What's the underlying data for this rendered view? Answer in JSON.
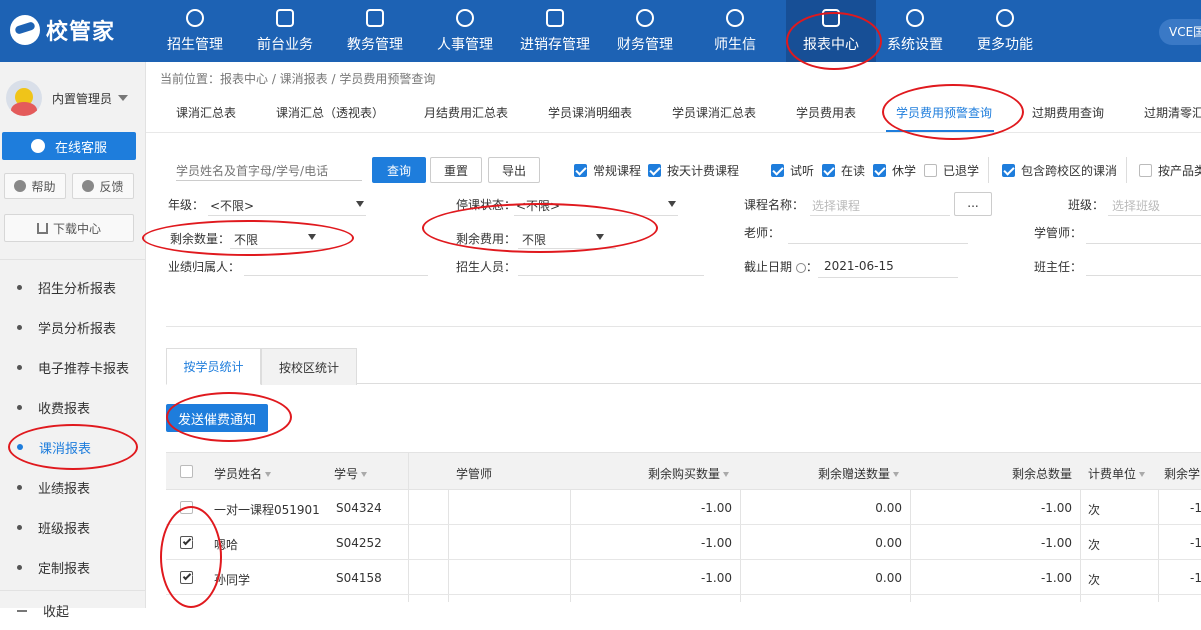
{
  "app": {
    "logo_text": "校管家",
    "user_badge": "VCE国"
  },
  "nav": [
    {
      "label": "招生管理",
      "icon": "user-plus-icon"
    },
    {
      "label": "前台业务",
      "icon": "id-card-icon"
    },
    {
      "label": "教务管理",
      "icon": "book-icon"
    },
    {
      "label": "人事管理",
      "icon": "person-icon"
    },
    {
      "label": "进销存管理",
      "icon": "inventory-icon"
    },
    {
      "label": "财务管理",
      "icon": "finance-icon"
    },
    {
      "label": "师生信",
      "icon": "chat-icon"
    },
    {
      "label": "报表中心",
      "icon": "report-icon"
    },
    {
      "label": "系统设置",
      "icon": "settings-icon"
    },
    {
      "label": "更多功能",
      "icon": "more-icon"
    }
  ],
  "sidebar": {
    "user_name": "内置管理员",
    "support_label": "在线客服",
    "help_label": "帮助",
    "feedback_label": "反馈",
    "download_label": "下载中心",
    "items": [
      {
        "label": "招生分析报表"
      },
      {
        "label": "学员分析报表"
      },
      {
        "label": "电子推荐卡报表"
      },
      {
        "label": "收费报表"
      },
      {
        "label": "课消报表"
      },
      {
        "label": "业绩报表"
      },
      {
        "label": "班级报表"
      },
      {
        "label": "定制报表"
      },
      {
        "label": "收起"
      }
    ]
  },
  "breadcrumb": "当前位置：报表中心 / 课消报表 / 学员费用预警查询",
  "tabs": [
    {
      "label": "课消汇总表"
    },
    {
      "label": "课消汇总（透视表）"
    },
    {
      "label": "月结费用汇总表"
    },
    {
      "label": "学员课消明细表"
    },
    {
      "label": "学员课消汇总表"
    },
    {
      "label": "学员费用表"
    },
    {
      "label": "学员费用预警查询"
    },
    {
      "label": "过期费用查询"
    },
    {
      "label": "过期清零汇"
    }
  ],
  "search": {
    "placeholder": "学员姓名及首字母/学号/电话",
    "query_btn": "查询",
    "reset_btn": "重置",
    "export_btn": "导出"
  },
  "checks": [
    {
      "label": "常规课程",
      "checked": true
    },
    {
      "label": "按天计费课程",
      "checked": true
    },
    {
      "label": "试听",
      "checked": true
    },
    {
      "label": "在读",
      "checked": true
    },
    {
      "label": "休学",
      "checked": true
    },
    {
      "label": "已退学",
      "checked": false
    },
    {
      "label": "包含跨校区的课消",
      "checked": true
    },
    {
      "label": "按产品类",
      "checked": false
    }
  ],
  "filters": {
    "grade_label": "年级：",
    "grade_value": "<不限>",
    "stop_label": "停课状态：",
    "stop_value": "<不限>",
    "course_label": "课程名称：",
    "course_placeholder": "选择课程",
    "course_more": "...",
    "class_label": "班级：",
    "class_placeholder": "选择班级",
    "remain_qty_label": "剩余数量：",
    "remain_qty_value": "不限",
    "remain_fee_label": "剩余费用：",
    "remain_fee_value": "不限",
    "teacher_label": "老师：",
    "manager_label": "学管师：",
    "owner_label": "业绩归属人：",
    "recruiter_label": "招生人员：",
    "deadline_label": "截止日期",
    "deadline_value": "2021-06-15",
    "head_teacher_label": "班主任："
  },
  "stat_tabs": [
    {
      "label": "按学员统计"
    },
    {
      "label": "按校区统计"
    }
  ],
  "notify_btn": "发送催费通知",
  "table": {
    "headers": [
      "学员姓名",
      "学号",
      "学管师",
      "剩余购买数量",
      "剩余赠送数量",
      "剩余总数量",
      "计费单位",
      "剩余学"
    ],
    "rows": [
      {
        "name": "一对一课程051901",
        "id": "S04324",
        "manager": "",
        "buy": "-1.00",
        "gift": "0.00",
        "total": "-1.00",
        "unit": "次",
        "rest": "-1",
        "checked": false
      },
      {
        "name": "嗯哈",
        "id": "S04252",
        "manager": "",
        "buy": "-1.00",
        "gift": "0.00",
        "total": "-1.00",
        "unit": "次",
        "rest": "-1",
        "checked": true
      },
      {
        "name": "孙同学",
        "id": "S04158",
        "manager": "",
        "buy": "-1.00",
        "gift": "0.00",
        "total": "-1.00",
        "unit": "次",
        "rest": "-1",
        "checked": true
      }
    ]
  },
  "colors": {
    "primary": "#1e7ddc",
    "topbar": "#1d62b4",
    "annotation": "#e0191e"
  }
}
